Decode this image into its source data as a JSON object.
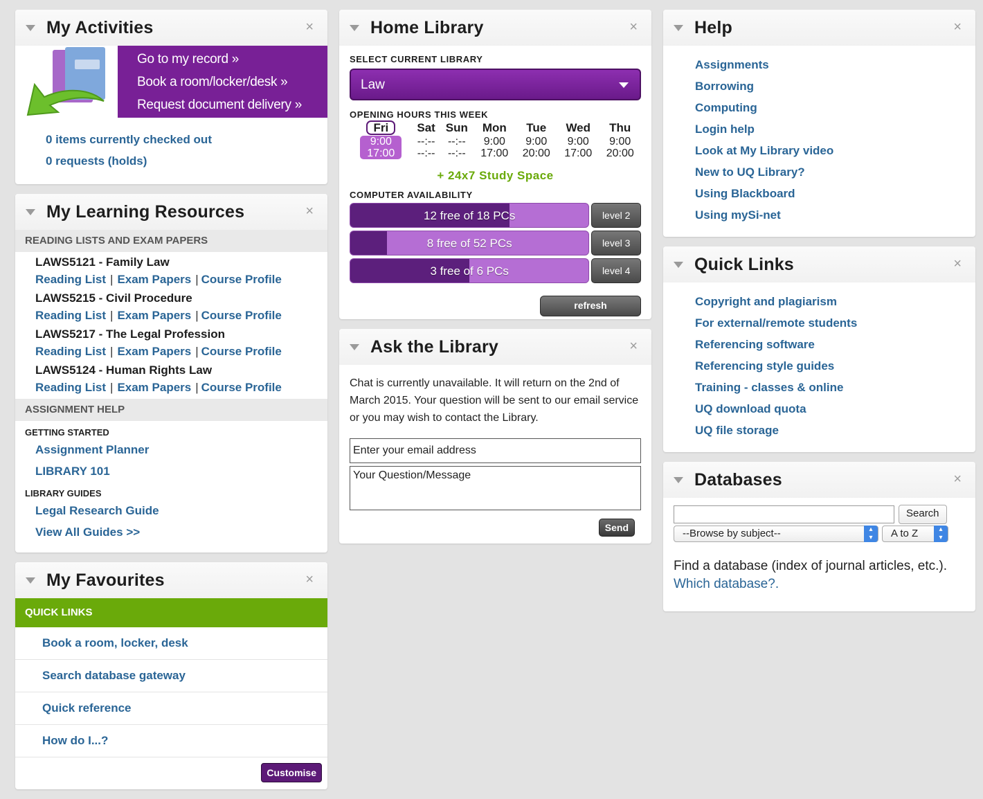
{
  "activities": {
    "title": "My Activities",
    "close": "×",
    "links": [
      "Go to my record »",
      "Book a room/locker/desk »",
      "Request document delivery »"
    ],
    "checked_out": "0 items currently checked out",
    "requests": "0 requests (holds)"
  },
  "learning": {
    "title": "My Learning Resources",
    "close": "×",
    "reading_header": "READING LISTS AND EXAM PAPERS",
    "link_labels": {
      "reading": "Reading List",
      "exam": "Exam Papers",
      "profile": "Course Profile",
      "sep": "|"
    },
    "courses": [
      {
        "name": "LAWS5121 - Family Law"
      },
      {
        "name": "LAWS5215 - Civil Procedure"
      },
      {
        "name": "LAWS5217 - The Legal Profession"
      },
      {
        "name": "LAWS5124 - Human Rights Law"
      }
    ],
    "assignment_header": "ASSIGNMENT HELP",
    "getting_started": "GETTING STARTED",
    "getting_links": [
      "Assignment Planner",
      "LIBRARY 101"
    ],
    "guides_header": "LIBRARY GUIDES",
    "guides_links": [
      "Legal Research Guide",
      "View All Guides >>"
    ]
  },
  "favourites": {
    "title": "My Favourites",
    "close": "×",
    "bar": "QUICK LINKS",
    "items": [
      "Book a room, locker, desk",
      "Search database gateway",
      "Quick reference",
      "How do I...?"
    ],
    "customise": "Customise"
  },
  "home_library": {
    "title": "Home Library",
    "close": "×",
    "select_label": "SELECT CURRENT LIBRARY",
    "selected": "Law",
    "hours_label": "OPENING HOURS THIS WEEK",
    "days": [
      "Fri",
      "Sat",
      "Sun",
      "Mon",
      "Tue",
      "Wed",
      "Thu"
    ],
    "open": [
      "9:00",
      "--:--",
      "--:--",
      "9:00",
      "9:00",
      "9:00",
      "9:00"
    ],
    "close_times": [
      "17:00",
      "--:--",
      "--:--",
      "17:00",
      "20:00",
      "17:00",
      "20:00"
    ],
    "study_space": "+ 24x7 Study Space",
    "computer_label": "COMPUTER AVAILABILITY",
    "computers": [
      {
        "text": "12 free of 18 PCs",
        "level": "level 2",
        "free": 12,
        "total": 18
      },
      {
        "text": "8 free of 52 PCs",
        "level": "level 3",
        "free": 8,
        "total": 52
      },
      {
        "text": "3 free of 6 PCs",
        "level": "level 4",
        "free": 3,
        "total": 6
      }
    ],
    "refresh": "refresh"
  },
  "ask": {
    "title": "Ask the Library",
    "close": "×",
    "message": "Chat is currently unavailable. It will return on the 2nd of March 2015. Your question will be sent to our email service or you may wish to contact the Library.",
    "email_value": "Enter your email address",
    "question_value": "Your Question/Message",
    "send": "Send"
  },
  "help": {
    "title": "Help",
    "close": "×",
    "links": [
      "Assignments",
      "Borrowing",
      "Computing",
      "Login help",
      "Look at My Library video",
      "New to UQ Library?",
      "Using Blackboard",
      "Using mySi-net"
    ]
  },
  "quick_links": {
    "title": "Quick Links",
    "close": "×",
    "links": [
      "Copyright and plagiarism",
      "For external/remote students",
      "Referencing software",
      "Referencing style guides",
      "Training - classes & online",
      "UQ download quota",
      "UQ file storage"
    ]
  },
  "databases": {
    "title": "Databases",
    "close": "×",
    "search_button": "Search",
    "browse_select": "--Browse by subject--",
    "atoz_select": "A to Z",
    "text": "Find a database (index of journal articles, etc.).",
    "which_link": "Which database?."
  },
  "colors": {
    "purple": "#782096",
    "link": "#2a6596",
    "green": "#6aaa0a"
  }
}
